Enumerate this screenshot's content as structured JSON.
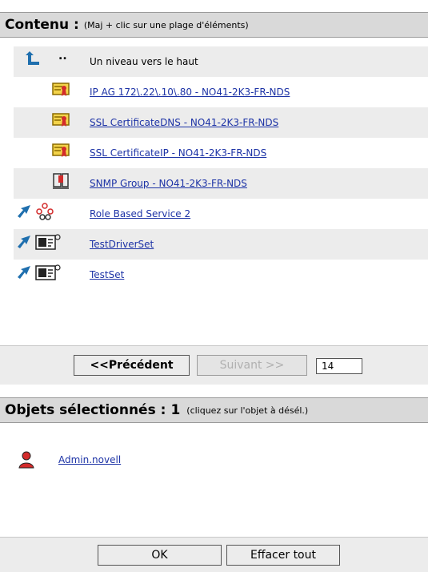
{
  "content_header": {
    "title": "Contenu :",
    "hint": "(Maj + clic sur une plage d'éléments)"
  },
  "items": [
    {
      "label": "Un niveau vers le haut",
      "prefix": "..",
      "icon": "up-level-icon",
      "link": false
    },
    {
      "label": "IP AG 172\\.22\\.10\\.80 - NO41-2K3-FR-NDS",
      "icon": "certificate-icon",
      "link": true
    },
    {
      "label": "SSL CertificateDNS - NO41-2K3-FR-NDS",
      "icon": "certificate-icon",
      "link": true
    },
    {
      "label": "SSL CertificateIP - NO41-2K3-FR-NDS",
      "icon": "certificate-icon",
      "link": true
    },
    {
      "label": "SNMP Group - NO41-2K3-FR-NDS",
      "icon": "snmp-group-icon",
      "link": true
    },
    {
      "label": "Role Based Service 2",
      "icon": "role-service-icon",
      "link": true
    },
    {
      "label": "TestDriverSet",
      "icon": "driver-set-icon",
      "link": true
    },
    {
      "label": "TestSet",
      "icon": "driver-set-icon",
      "link": true
    }
  ],
  "pager": {
    "prev_label": "<<Précédent",
    "next_label": "Suivant >>",
    "page_size": "14"
  },
  "selected_header": {
    "title": "Objets sélectionnés :",
    "count": "1",
    "hint": "(cliquez sur l'objet à désél.)"
  },
  "selected_items": [
    {
      "label": "Admin.novell",
      "icon": "user-icon"
    }
  ],
  "footer": {
    "ok_label": "OK",
    "clear_label": "Effacer tout"
  },
  "colors": {
    "link": "#1d33a6",
    "header_bg": "#d9d9d9",
    "shade_bg": "#ececec"
  }
}
